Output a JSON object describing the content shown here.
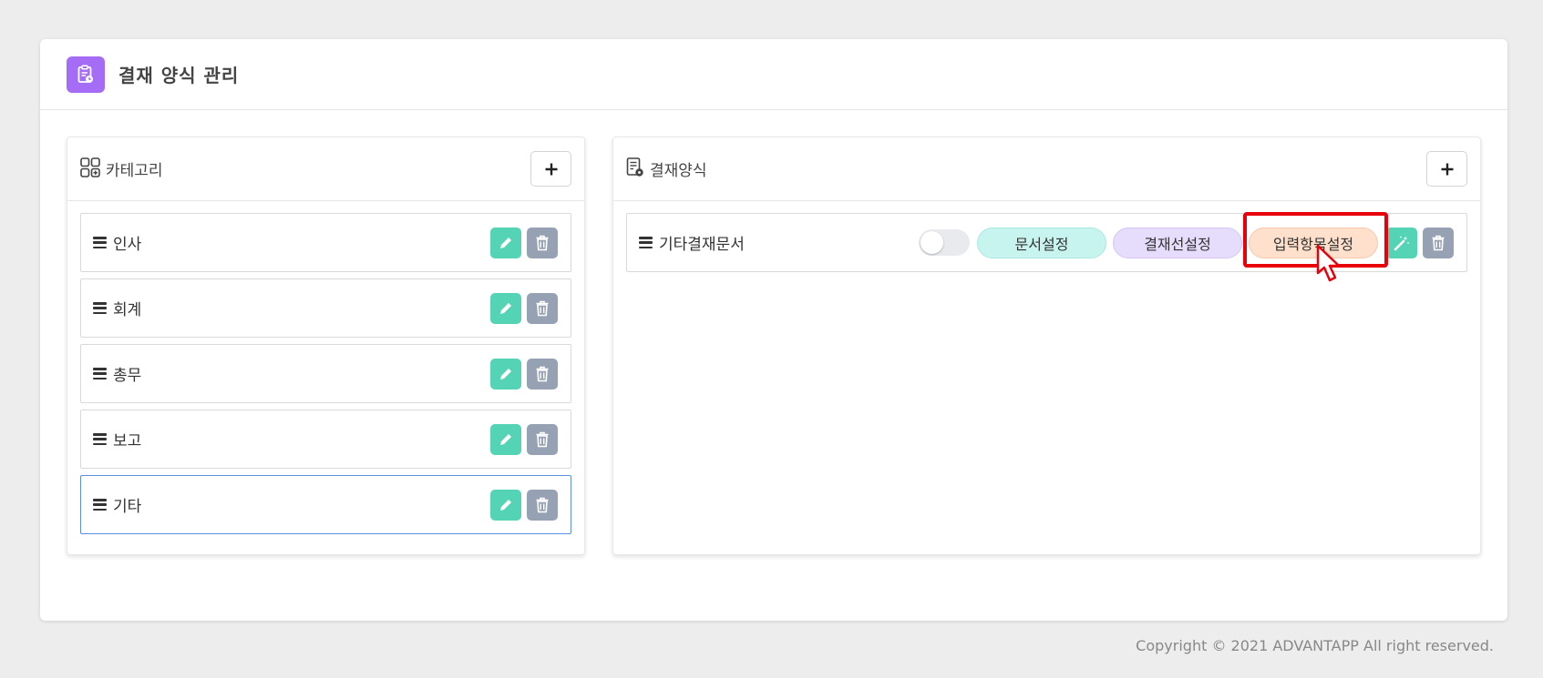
{
  "page": {
    "title": "결재 양식 관리",
    "title_icon": "clipboard-document-icon"
  },
  "category_panel": {
    "title": "카테고리",
    "title_icon": "grid-icon",
    "add_icon": "plus-icon",
    "items": [
      {
        "label": "인사"
      },
      {
        "label": "회계"
      },
      {
        "label": "총무"
      },
      {
        "label": "보고"
      },
      {
        "label": "기타",
        "selected": true
      }
    ]
  },
  "form_panel": {
    "title": "결재양식",
    "title_icon": "document-settings-icon",
    "add_icon": "plus-icon",
    "items": [
      {
        "label": "기타결재문서",
        "toggle_on": false,
        "doc_settings_label": "문서설정",
        "approval_line_label": "결재선설정",
        "input_fields_label": "입력항목설정",
        "highlighted": "input_fields"
      }
    ]
  },
  "colors": {
    "accent_purple": "#a56cf5",
    "edit_green": "#55d3b5",
    "delete_gray": "#96a2b4",
    "highlight_red": "#e8000b"
  },
  "footer": {
    "copyright": "Copyright © 2021 ADVANTAPP All right reserved."
  }
}
